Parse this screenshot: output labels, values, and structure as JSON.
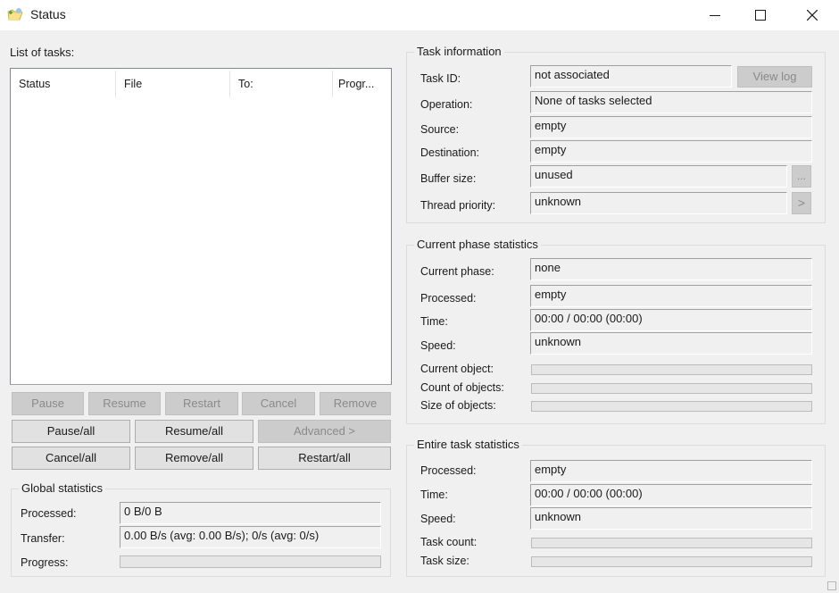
{
  "window": {
    "title": "Status",
    "icon": "folder-arrow-icon",
    "controls": {
      "minimize": "minimize-icon",
      "maximize": "maximize-icon",
      "close": "close-icon"
    }
  },
  "tasks_list": {
    "label": "List of tasks:",
    "columns": [
      "Status",
      "File",
      "To:",
      "Progr..."
    ],
    "rows": []
  },
  "task_buttons": {
    "row1": [
      {
        "label": "Pause",
        "enabled": false
      },
      {
        "label": "Resume",
        "enabled": false
      },
      {
        "label": "Restart",
        "enabled": false
      },
      {
        "label": "Cancel",
        "enabled": false
      },
      {
        "label": "Remove",
        "enabled": false
      }
    ],
    "row2": [
      {
        "label": "Pause/all",
        "enabled": true
      },
      {
        "label": "Resume/all",
        "enabled": true
      },
      {
        "label": "Advanced >",
        "enabled": false
      }
    ],
    "row3": [
      {
        "label": "Cancel/all",
        "enabled": true
      },
      {
        "label": "Remove/all",
        "enabled": true
      },
      {
        "label": "Restart/all",
        "enabled": true
      }
    ]
  },
  "global_statistics": {
    "title": "Global statistics",
    "processed_label": "Processed:",
    "processed_value": "0 B/0 B",
    "transfer_label": "Transfer:",
    "transfer_value": "0.00 B/s (avg: 0.00 B/s); 0/s (avg: 0/s)",
    "progress_label": "Progress:",
    "progress_percent": 0
  },
  "task_information": {
    "title": "Task information",
    "task_id_label": "Task ID:",
    "task_id_value": "not associated",
    "view_log_label": "View log",
    "operation_label": "Operation:",
    "operation_value": "None of tasks selected",
    "source_label": "Source:",
    "source_value": "empty",
    "destination_label": "Destination:",
    "destination_value": "empty",
    "buffer_size_label": "Buffer size:",
    "buffer_size_value": "unused",
    "buffer_button_label": "...",
    "thread_priority_label": "Thread priority:",
    "thread_priority_value": "unknown",
    "thread_button_label": ">"
  },
  "current_phase": {
    "title": "Current phase statistics",
    "phase_label": "Current phase:",
    "phase_value": "none",
    "processed_label": "Processed:",
    "processed_value": "empty",
    "time_label": "Time:",
    "time_value": "00:00 / 00:00 (00:00)",
    "speed_label": "Speed:",
    "speed_value": "unknown",
    "current_object_label": "Current object:",
    "current_object_percent": 0,
    "count_objects_label": "Count of objects:",
    "count_objects_percent": 0,
    "size_objects_label": "Size of objects:",
    "size_objects_percent": 0
  },
  "entire_task": {
    "title": "Entire task statistics",
    "processed_label": "Processed:",
    "processed_value": "empty",
    "time_label": "Time:",
    "time_value": "00:00 / 00:00 (00:00)",
    "speed_label": "Speed:",
    "speed_value": "unknown",
    "task_count_label": "Task count:",
    "task_count_percent": 0,
    "task_size_label": "Task size:",
    "task_size_percent": 0
  }
}
